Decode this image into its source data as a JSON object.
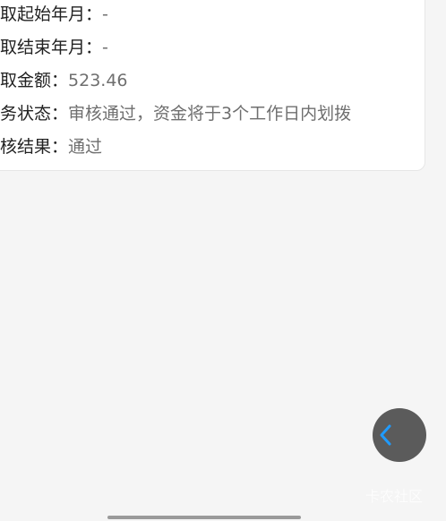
{
  "detail": {
    "rows": [
      {
        "label": "提取起始年月：",
        "value": "-"
      },
      {
        "label": "提取结束年月：",
        "value": "-"
      },
      {
        "label": "提取金额：",
        "value": "523.46"
      },
      {
        "label": "业务状态：",
        "value": "审核通过，资金将于3个工作日内划拨"
      },
      {
        "label": "审核结果：",
        "value": "通过"
      }
    ]
  },
  "floating_button": {
    "icon": "chevron-left-icon",
    "icon_color": "#1f9bff",
    "background": "#5b5b5b"
  },
  "watermark": {
    "text": "卡农社区"
  }
}
